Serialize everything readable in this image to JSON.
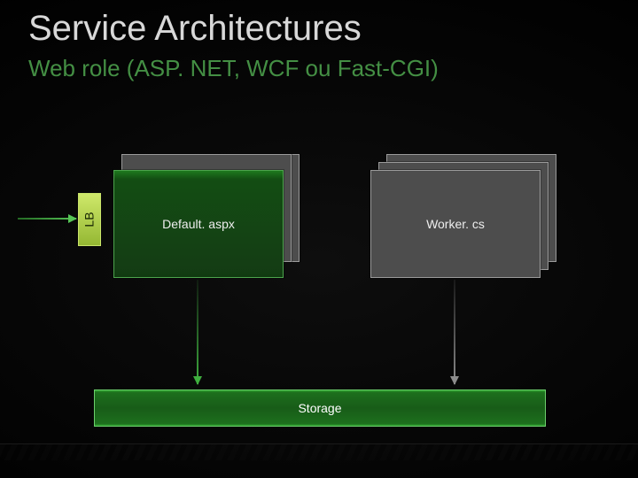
{
  "title": "Service Architectures",
  "subtitle": "Web role (ASP. NET, WCF ou Fast-CGI)",
  "lb_label": "LB",
  "web_front_label": "Default. aspx",
  "worker_front_label": "Worker. cs",
  "storage_label": "Storage"
}
